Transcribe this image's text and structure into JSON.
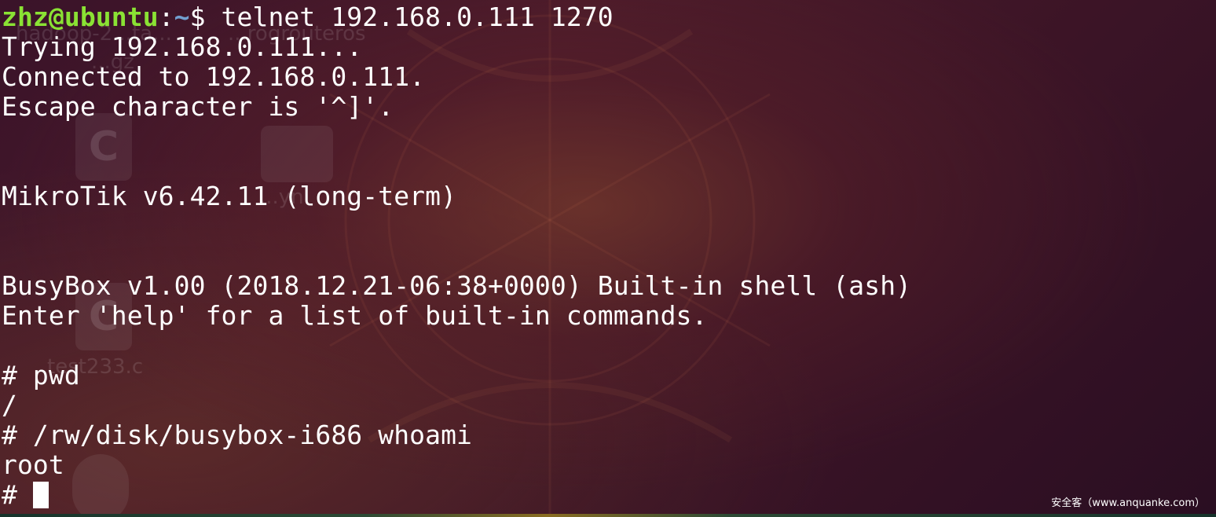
{
  "colors": {
    "prompt_user": "#8ae234",
    "prompt_path": "#729fcf",
    "text": "#ffffff"
  },
  "desktop": {
    "faded_labels": [
      "hadoop-2...ta...",
      "...gz",
      "...rogrouteros",
      "...yn",
      "test233.c"
    ],
    "faded_icon_glyphs": [
      "C",
      "C"
    ]
  },
  "terminal": {
    "prompt": {
      "user_host": "zhz@ubuntu",
      "separator": ":",
      "path": "~",
      "symbol": "$",
      "command": " telnet 192.168.0.111 1270"
    },
    "lines": [
      "Trying 192.168.0.111...",
      "Connected to 192.168.0.111.",
      "Escape character is '^]'.",
      "MikroTik v6.42.11 (long-term)",
      "BusyBox v1.00 (2018.12.21-06:38+0000) Built-in shell (ash)",
      "Enter 'help' for a list of built-in commands.",
      "# pwd",
      "/",
      "# /rw/disk/busybox-i686 whoami",
      "root"
    ],
    "final_prompt": "# "
  },
  "watermark": "安全客（www.anquanke.com）"
}
